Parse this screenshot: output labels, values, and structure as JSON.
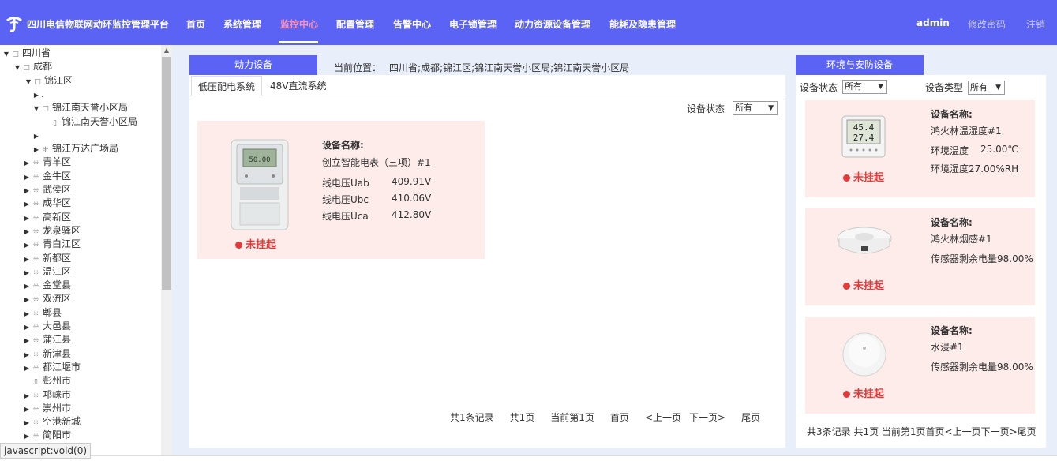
{
  "header": {
    "brand": "四川电信物联网动环监控管理平台",
    "nav": [
      "首页",
      "系统管理",
      "监控中心",
      "配置管理",
      "告警中心",
      "电子锁管理",
      "动力资源设备管理",
      "能耗及隐患管理"
    ],
    "active_nav": "监控中心",
    "user": "admin",
    "change_password": "修改密码",
    "logout": "注销"
  },
  "tree": {
    "items": [
      {
        "label": "四川省",
        "state": "expanded",
        "icon": "folder-icon"
      },
      {
        "label": "成都",
        "state": "expanded",
        "icon": "folder-icon"
      },
      {
        "label": "锦江区",
        "state": "expanded",
        "icon": "folder-icon"
      },
      {
        "label": ".",
        "state": "collapsed",
        "icon": ""
      },
      {
        "label": "锦江南天誉小区局",
        "state": "expanded",
        "icon": "folder-icon"
      },
      {
        "label": "锦江南天誉小区局",
        "state": "leaf",
        "icon": "file-icon"
      },
      {
        "label": "",
        "state": "collapsed",
        "icon": ""
      },
      {
        "label": "锦江万达广场局",
        "state": "collapsed",
        "icon": "node-icon"
      },
      {
        "label": "青羊区",
        "state": "collapsed",
        "icon": "node-icon"
      },
      {
        "label": "金牛区",
        "state": "collapsed",
        "icon": "node-icon"
      },
      {
        "label": "武侯区",
        "state": "collapsed",
        "icon": "node-icon"
      },
      {
        "label": "成华区",
        "state": "collapsed",
        "icon": "node-icon"
      },
      {
        "label": "高新区",
        "state": "collapsed",
        "icon": "node-icon"
      },
      {
        "label": "龙泉驿区",
        "state": "collapsed",
        "icon": "node-icon"
      },
      {
        "label": "青白江区",
        "state": "collapsed",
        "icon": "node-icon"
      },
      {
        "label": "新都区",
        "state": "collapsed",
        "icon": "node-icon"
      },
      {
        "label": "温江区",
        "state": "collapsed",
        "icon": "node-icon"
      },
      {
        "label": "金堂县",
        "state": "collapsed",
        "icon": "node-icon"
      },
      {
        "label": "双流区",
        "state": "collapsed",
        "icon": "node-icon"
      },
      {
        "label": "郫县",
        "state": "collapsed",
        "icon": "node-icon"
      },
      {
        "label": "大邑县",
        "state": "collapsed",
        "icon": "node-icon"
      },
      {
        "label": "蒲江县",
        "state": "collapsed",
        "icon": "node-icon"
      },
      {
        "label": "新津县",
        "state": "collapsed",
        "icon": "node-icon"
      },
      {
        "label": "都江堰市",
        "state": "collapsed",
        "icon": "node-icon"
      },
      {
        "label": "彭州市",
        "state": "leaf",
        "icon": "file-icon"
      },
      {
        "label": "邛崃市",
        "state": "collapsed",
        "icon": "node-icon"
      },
      {
        "label": "崇州市",
        "state": "collapsed",
        "icon": "node-icon"
      },
      {
        "label": "空港新城",
        "state": "collapsed",
        "icon": "node-icon"
      },
      {
        "label": "简阳市",
        "state": "collapsed",
        "icon": "node-icon"
      }
    ]
  },
  "power": {
    "tab_label": "动力设备",
    "breadcrumb_label": "当前位置：",
    "breadcrumb": "四川省;成都;锦江区;锦江南天誉小区局;锦江南天誉小区局",
    "subtabs": [
      "低压配电系统",
      "48V直流系统"
    ],
    "status_label": "设备状态",
    "status_value": "所有",
    "card": {
      "title": "设备名称:",
      "name": "创立智能电表（三项）#1",
      "rows": [
        {
          "label": "线电压Uab",
          "value": "409.91V"
        },
        {
          "label": "线电压Ubc",
          "value": "410.06V"
        },
        {
          "label": "线电压Uca",
          "value": "412.80V"
        }
      ],
      "status": "未挂起",
      "meter_display": "50.00"
    },
    "pager": [
      "共1条记录",
      "共1页",
      "当前第1页",
      "首页",
      "<上一页",
      "下一页>",
      "尾页"
    ]
  },
  "env": {
    "tab_label": "环境与安防设备",
    "status_label": "设备状态",
    "status_value": "所有",
    "type_label": "设备类型",
    "type_value": "所有",
    "cards": [
      {
        "title": "设备名称:",
        "name": "鸿火林温湿度#1",
        "line1_label": "环境温度",
        "line1_value": "25.00℃",
        "line2": "环境湿度27.00%RH",
        "status": "未挂起",
        "display_top": "45.4",
        "display_bottom": "27.4"
      },
      {
        "title": "设备名称:",
        "name": "鸿火林烟感#1",
        "line1": "传感器剩余电量98.00%",
        "status": "未挂起"
      },
      {
        "title": "设备名称:",
        "name": "水浸#1",
        "line1": "传感器剩余电量98.00%",
        "status": "未挂起"
      }
    ],
    "pager": "共3条记录 共1页 当前第1页首页<上一页下一页>尾页"
  },
  "status_hint": "javascript:void(0)"
}
